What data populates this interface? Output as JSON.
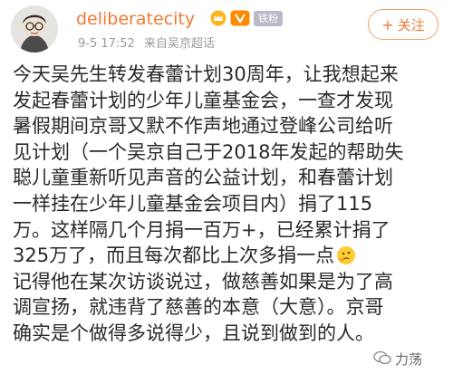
{
  "user": {
    "name": "deliberatecity",
    "badge_fan_label": "铁粉",
    "timestamp": "9-5 17:52",
    "source": "来自吴京超话"
  },
  "follow_button": {
    "plus": "+",
    "label": "关注"
  },
  "post": {
    "lines": [
      "今天吴先生转发春蕾计划30周年，让我想起来",
      "发起春蕾计划的少年儿童基金会，一查才发现",
      "暑假期间京哥又默不作声地通过登峰公司给听",
      "见计划（一个吴京自己于2018年发起的帮助失",
      "聪儿童重新听见声音的公益计划，和春蕾计划",
      "一样挂在少年儿童基金会项目内）捐了115",
      "万。这样隔几个月捐一百万+，已经累计捐了",
      "325万了，而且每次都比上次多捐一点",
      "记得他在某次访谈说过，做慈善如果是为了高",
      "调宣扬，就违背了慈善的本意（大意）。京哥",
      "确实是个做得多说得少，且说到做到的人。"
    ]
  },
  "watermark": {
    "text": "力荡"
  },
  "colors": {
    "username": "#f07a32",
    "meta": "#9a9a9a",
    "body_text": "#2a2a2a",
    "fan_badge_bg": "#b9b9c8"
  },
  "icons": [
    "avatar-illustration",
    "crown-icon",
    "gold-badge-icon",
    "thinking-emoji",
    "wechat-icon"
  ]
}
